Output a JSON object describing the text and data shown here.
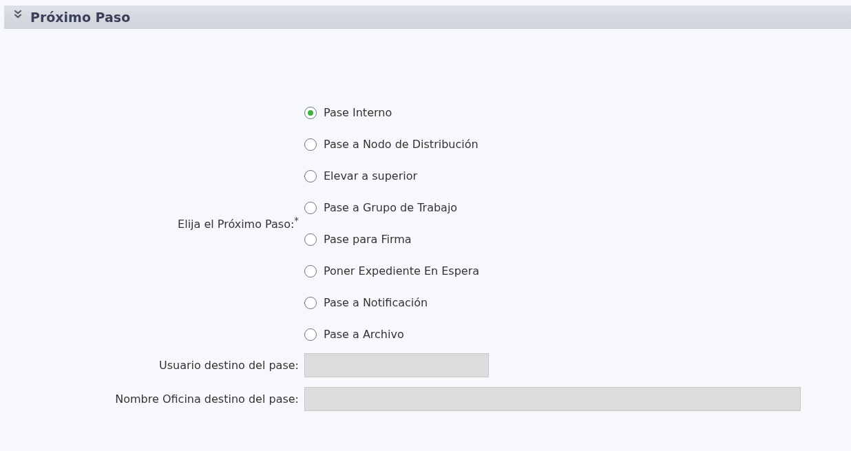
{
  "section": {
    "title": "Próximo Paso",
    "expanded": true
  },
  "step_choice": {
    "label": "Elija el Próximo Paso:$^{*}$",
    "options": [
      {
        "label": "Pase Interno",
        "selected": true
      },
      {
        "label": "Pase a Nodo de Distribución",
        "selected": false
      },
      {
        "label": "Elevar a superior",
        "selected": false
      },
      {
        "label": "Pase a Grupo de Trabajo",
        "selected": false
      },
      {
        "label": "Pase para Firma",
        "selected": false
      },
      {
        "label": "Poner Expediente En Espera",
        "selected": false
      },
      {
        "label": "Pase a Notificación",
        "selected": false
      },
      {
        "label": "Pase a Archivo",
        "selected": false
      }
    ]
  },
  "fields": [
    {
      "label": "Usuario destino del pase:",
      "disabled": true
    },
    {
      "label": "Nombre Oficina destino del pase:",
      "disabled": true
    }
  ]
}
